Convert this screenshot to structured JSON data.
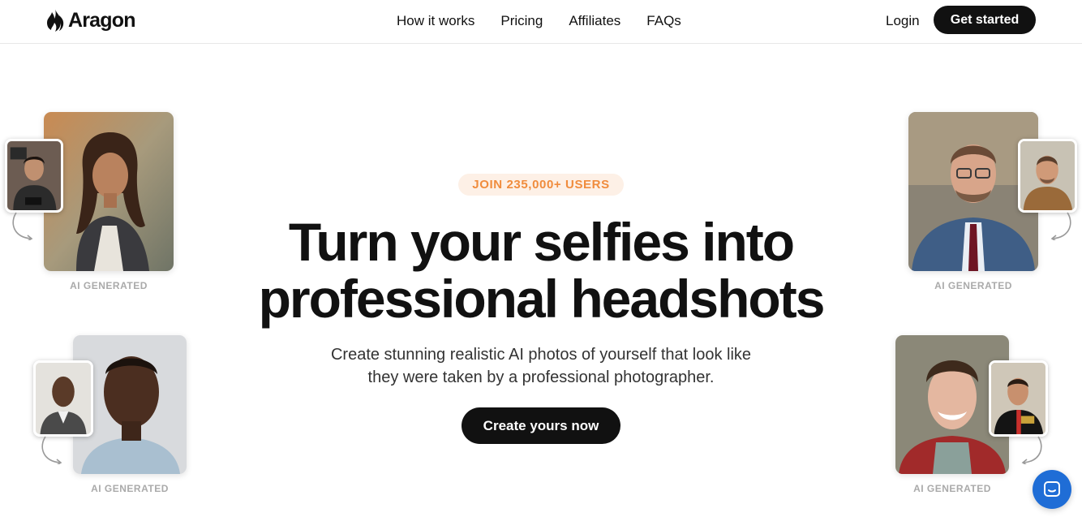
{
  "brand": {
    "name": "Aragon"
  },
  "nav": {
    "items": [
      {
        "label": "How it works"
      },
      {
        "label": "Pricing"
      },
      {
        "label": "Affiliates"
      },
      {
        "label": "FAQs"
      }
    ],
    "login_label": "Login",
    "get_started_label": "Get started"
  },
  "hero": {
    "badge": "JOIN 235,000+ USERS",
    "title_line1": "Turn your selfies into",
    "title_line2": "professional headshots",
    "subtitle_line1": "Create stunning realistic AI photos of yourself that look like",
    "subtitle_line2": "they were taken by a professional photographer.",
    "cta_label": "Create yours now"
  },
  "examples": {
    "ai_label": "AI GENERATED"
  },
  "colors": {
    "accent": "#f08c3d",
    "badge_bg": "#fdf0e6",
    "button": "#111111",
    "chat": "#1f6dd6"
  },
  "icons": {
    "logo": "flame-icon",
    "arrow": "curved-arrow-icon",
    "chat": "chat-bubble-icon"
  }
}
